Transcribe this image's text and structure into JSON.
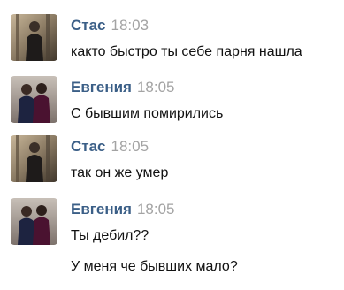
{
  "messages": [
    {
      "sender": "Стас",
      "time": "18:03",
      "avatar_icon": "user-avatar-stas",
      "lines": [
        "както быстро ты себе парня нашла"
      ]
    },
    {
      "sender": "Евгения",
      "time": "18:05",
      "avatar_icon": "user-avatar-evgeniya",
      "lines": [
        "С бывшим помирились"
      ]
    },
    {
      "sender": "Стас",
      "time": "18:05",
      "avatar_icon": "user-avatar-stas",
      "lines": [
        "так он же умер"
      ]
    },
    {
      "sender": "Евгения",
      "time": "18:05",
      "avatar_icon": "user-avatar-evgeniya",
      "lines": [
        "Ты дебил??",
        "У меня че бывших мало?"
      ]
    }
  ],
  "colors": {
    "name": "#3b5f87",
    "time": "#a3a3a3",
    "text": "#111111",
    "background": "#ffffff"
  }
}
